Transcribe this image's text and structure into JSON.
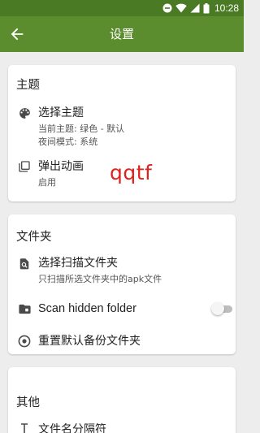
{
  "status_bar": {
    "time": "10:28",
    "icons": [
      "dnd-icon",
      "wifi-icon",
      "signal-icon",
      "battery-icon"
    ]
  },
  "app_bar": {
    "title": "设置",
    "back_icon": "arrow-back-icon"
  },
  "colors": {
    "primary": "#5b8c2e",
    "status_bar": "#4b7a25",
    "background": "#ededed",
    "watermark": "#e0211d"
  },
  "theme_section": {
    "title": "主题",
    "select_theme": {
      "icon": "palette-icon",
      "title": "选择主题",
      "current_theme": "当前主题: 绿色 - 默认",
      "night_mode": "夜间模式: 系统"
    },
    "popup_animation": {
      "icon": "layers-icon",
      "title": "弹出动画",
      "value": "启用"
    }
  },
  "watermark": "qqtf",
  "folder_section": {
    "title": "文件夹",
    "scan_folder": {
      "icon": "folder-search-icon",
      "title": "选择扫描文件夹",
      "description": "只扫描所选文件夹中的apk文件"
    },
    "hidden_folder": {
      "icon": "folder-hidden-icon",
      "title": "Scan hidden folder",
      "enabled": false
    },
    "reset_backup": {
      "icon": "radio-target-icon",
      "title": "重置默认备份文件夹"
    }
  },
  "other_section": {
    "title": "其他",
    "separator": {
      "icon": "text-cursor-icon",
      "title": "文件名分隔符"
    }
  }
}
